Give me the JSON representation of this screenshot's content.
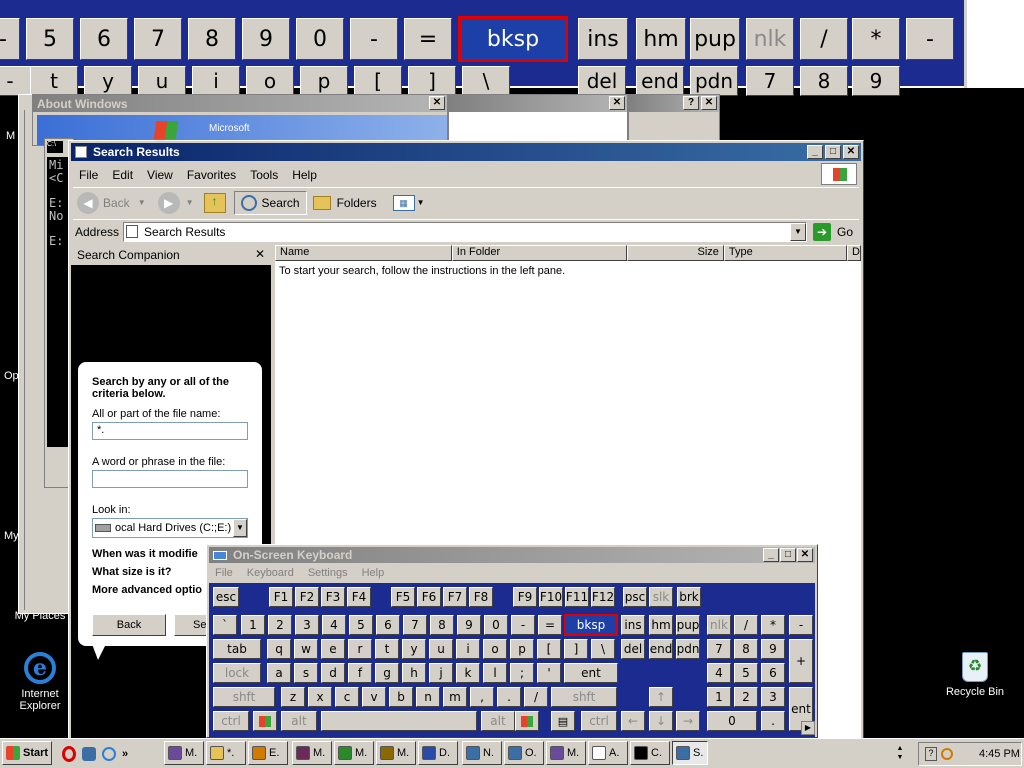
{
  "bigkb": {
    "row1": [
      "-",
      "5",
      "6",
      "7",
      "8",
      "9",
      "0",
      "-",
      "=",
      "bksp",
      "ins",
      "hm",
      "pup",
      "nlk",
      "/",
      "*",
      "-"
    ],
    "row2": [
      "-",
      "t",
      "y",
      "u",
      "i",
      "o",
      "p",
      "[",
      "]",
      "\\",
      "del",
      "end",
      "pdn",
      "7",
      "8",
      "9"
    ]
  },
  "about": {
    "title": "About Windows",
    "logo": "Microsoft"
  },
  "cmd": {
    "lines": [
      "Mi",
      "<C",
      "E:",
      "No",
      "E:"
    ]
  },
  "search": {
    "title": "Search Results",
    "menu": [
      "File",
      "Edit",
      "View",
      "Favorites",
      "Tools",
      "Help"
    ],
    "toolbar": {
      "back": "Back",
      "search": "Search",
      "folders": "Folders"
    },
    "address_label": "Address",
    "address_value": "Search Results",
    "go": "Go",
    "companion_title": "Search Companion",
    "columns": [
      "Name",
      "In Folder",
      "Size",
      "Type",
      "D"
    ],
    "empty_msg": "To start your search, follow the instructions in the left pane.",
    "panel": {
      "heading": "Search by any or all of the criteria below.",
      "file_name_label": "All or part of the file name:",
      "file_name_value": "*.",
      "phrase_label": "A word or phrase in the file:",
      "phrase_value": "",
      "lookin_label": "Look in:",
      "lookin_value": "ocal Hard Drives (C:;E:)",
      "when": "When was it modifie",
      "size": "What size is it?",
      "advanced": "More advanced optio",
      "back": "Back",
      "search": "Se"
    }
  },
  "osk": {
    "title": "On-Screen Keyboard",
    "menu": [
      "File",
      "Keyboard",
      "Settings",
      "Help"
    ],
    "row_f": [
      "esc",
      "F1",
      "F2",
      "F3",
      "F4",
      "F5",
      "F6",
      "F7",
      "F8",
      "F9",
      "F10",
      "F11",
      "F12",
      "psc",
      "slk",
      "brk"
    ],
    "row_num": [
      "`",
      "1",
      "2",
      "3",
      "4",
      "5",
      "6",
      "7",
      "8",
      "9",
      "0",
      "-",
      "=",
      "bksp",
      "ins",
      "hm",
      "pup",
      "nlk",
      "/",
      "*",
      "-"
    ],
    "row_q": [
      "tab",
      "q",
      "w",
      "e",
      "r",
      "t",
      "y",
      "u",
      "i",
      "o",
      "p",
      "[",
      "]",
      "\\",
      "del",
      "end",
      "pdn",
      "7",
      "8",
      "9",
      "+"
    ],
    "row_a": [
      "lock",
      "a",
      "s",
      "d",
      "f",
      "g",
      "h",
      "j",
      "k",
      "l",
      ";",
      "'",
      "ent",
      "4",
      "5",
      "6"
    ],
    "row_z": [
      "shft",
      "z",
      "x",
      "c",
      "v",
      "b",
      "n",
      "m",
      ",",
      ".",
      "/",
      "shft",
      "↑",
      "1",
      "2",
      "3",
      "ent"
    ],
    "row_b": [
      "ctrl",
      "alt",
      "alt",
      "ctrl",
      "←",
      "↓",
      "→",
      "0",
      "."
    ]
  },
  "desktop": {
    "ie": "Internet Explorer",
    "recycle": "Recycle Bin",
    "places": "My Places",
    "m1": "M",
    "op": "Op",
    "my": "My"
  },
  "taskbar": {
    "start": "Start",
    "items": [
      "M.",
      "*.",
      "E.",
      "M.",
      "M.",
      "M.",
      "D.",
      "N.",
      "O.",
      "M.",
      "A.",
      "C.",
      "S."
    ],
    "clock": "4:45 PM"
  },
  "colors": {
    "desktop_blue": "#3a6ea5",
    "osk_blue": "#1c2b8f",
    "title_blue": "#0a246a"
  }
}
